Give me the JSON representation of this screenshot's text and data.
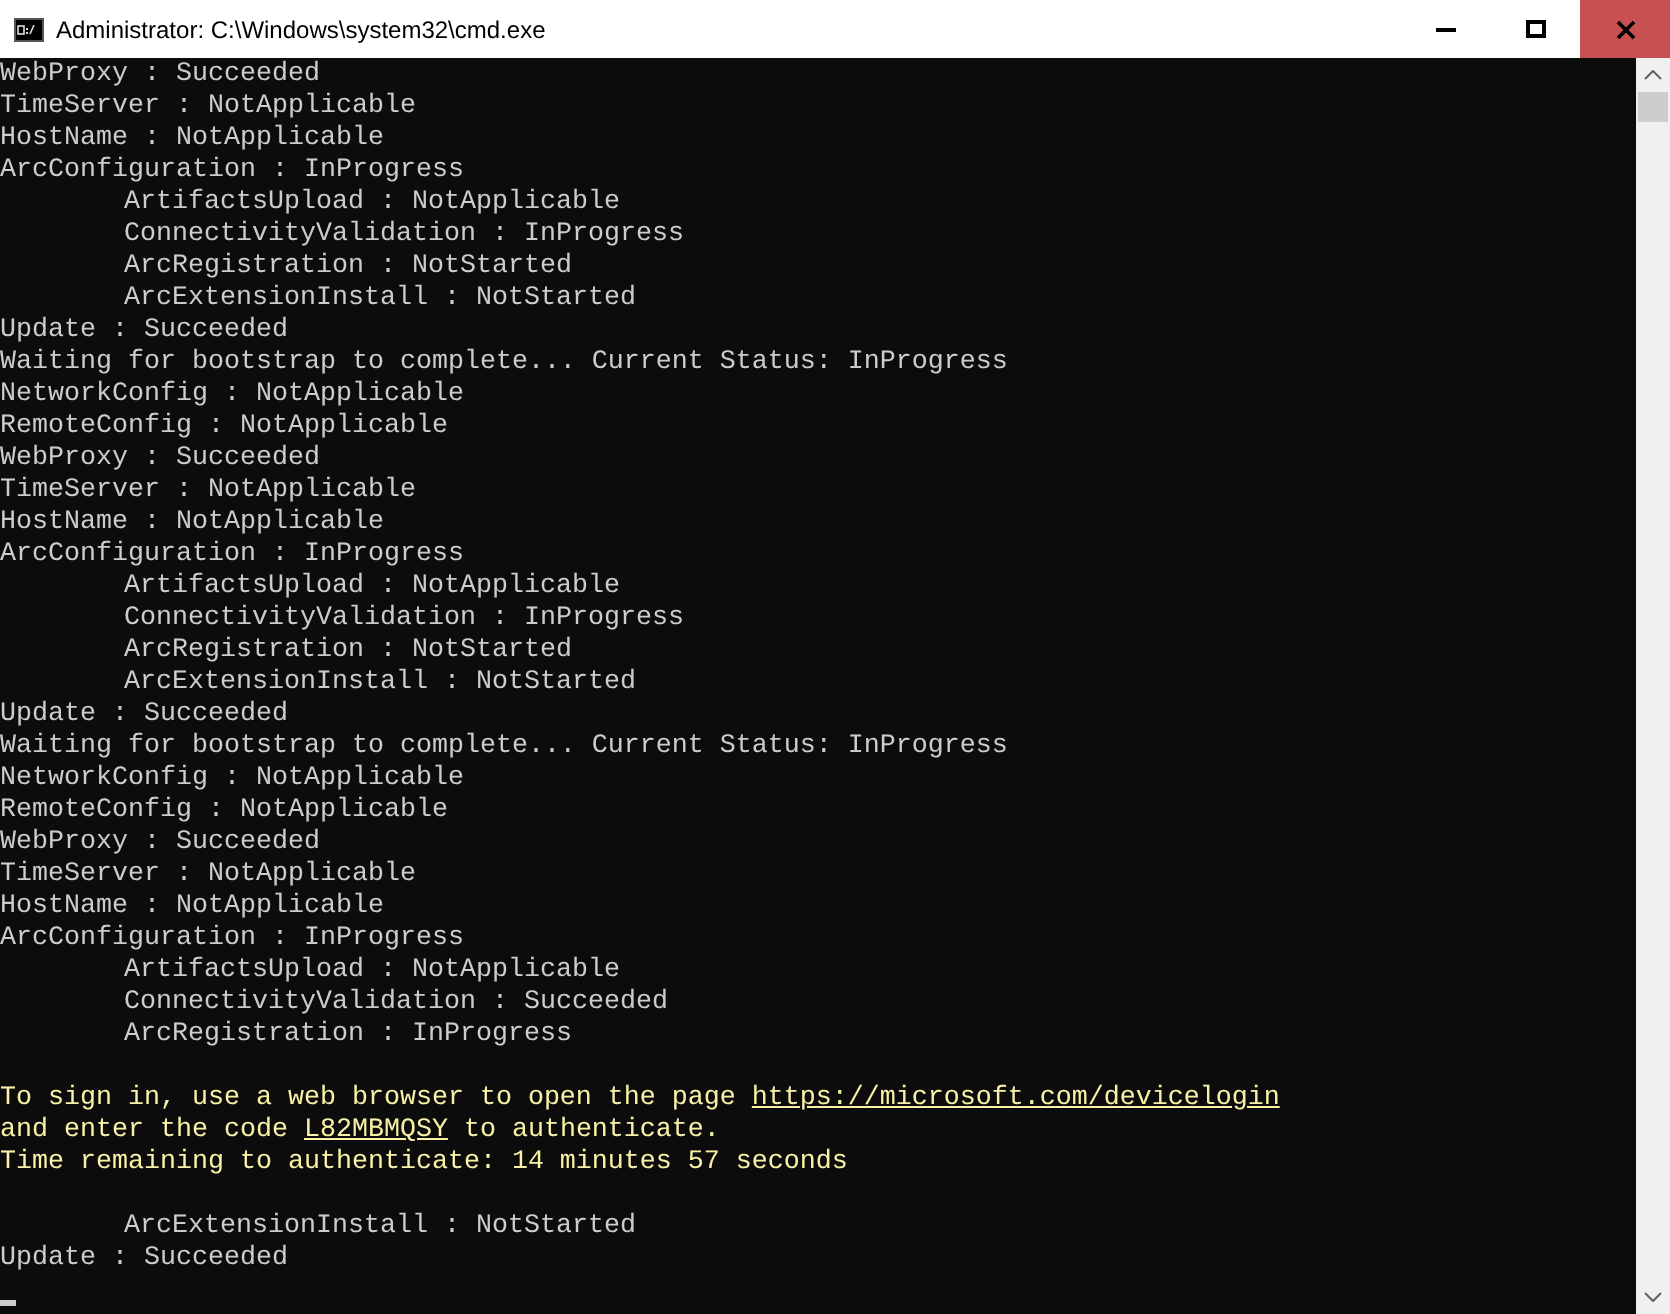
{
  "window": {
    "title": "Administrator: C:\\Windows\\system32\\cmd.exe"
  },
  "lines": [
    {
      "kind": "plain",
      "indented": false,
      "text": "WebProxy : Succeeded"
    },
    {
      "kind": "plain",
      "indented": false,
      "text": "TimeServer : NotApplicable"
    },
    {
      "kind": "plain",
      "indented": false,
      "text": "HostName : NotApplicable"
    },
    {
      "kind": "plain",
      "indented": false,
      "text": "ArcConfiguration : InProgress"
    },
    {
      "kind": "plain",
      "indented": true,
      "text": "ArtifactsUpload : NotApplicable"
    },
    {
      "kind": "plain",
      "indented": true,
      "text": "ConnectivityValidation : InProgress"
    },
    {
      "kind": "plain",
      "indented": true,
      "text": "ArcRegistration : NotStarted"
    },
    {
      "kind": "plain",
      "indented": true,
      "text": "ArcExtensionInstall : NotStarted"
    },
    {
      "kind": "plain",
      "indented": false,
      "text": "Update : Succeeded"
    },
    {
      "kind": "plain",
      "indented": false,
      "text": "Waiting for bootstrap to complete... Current Status: InProgress"
    },
    {
      "kind": "plain",
      "indented": false,
      "text": "NetworkConfig : NotApplicable"
    },
    {
      "kind": "plain",
      "indented": false,
      "text": "RemoteConfig : NotApplicable"
    },
    {
      "kind": "plain",
      "indented": false,
      "text": "WebProxy : Succeeded"
    },
    {
      "kind": "plain",
      "indented": false,
      "text": "TimeServer : NotApplicable"
    },
    {
      "kind": "plain",
      "indented": false,
      "text": "HostName : NotApplicable"
    },
    {
      "kind": "plain",
      "indented": false,
      "text": "ArcConfiguration : InProgress"
    },
    {
      "kind": "plain",
      "indented": true,
      "text": "ArtifactsUpload : NotApplicable"
    },
    {
      "kind": "plain",
      "indented": true,
      "text": "ConnectivityValidation : InProgress"
    },
    {
      "kind": "plain",
      "indented": true,
      "text": "ArcRegistration : NotStarted"
    },
    {
      "kind": "plain",
      "indented": true,
      "text": "ArcExtensionInstall : NotStarted"
    },
    {
      "kind": "plain",
      "indented": false,
      "text": "Update : Succeeded"
    },
    {
      "kind": "plain",
      "indented": false,
      "text": "Waiting for bootstrap to complete... Current Status: InProgress"
    },
    {
      "kind": "plain",
      "indented": false,
      "text": "NetworkConfig : NotApplicable"
    },
    {
      "kind": "plain",
      "indented": false,
      "text": "RemoteConfig : NotApplicable"
    },
    {
      "kind": "plain",
      "indented": false,
      "text": "WebProxy : Succeeded"
    },
    {
      "kind": "plain",
      "indented": false,
      "text": "TimeServer : NotApplicable"
    },
    {
      "kind": "plain",
      "indented": false,
      "text": "HostName : NotApplicable"
    },
    {
      "kind": "plain",
      "indented": false,
      "text": "ArcConfiguration : InProgress"
    },
    {
      "kind": "plain",
      "indented": true,
      "text": "ArtifactsUpload : NotApplicable"
    },
    {
      "kind": "plain",
      "indented": true,
      "text": "ConnectivityValidation : Succeeded"
    },
    {
      "kind": "plain",
      "indented": true,
      "text": "ArcRegistration : InProgress"
    },
    {
      "kind": "blank"
    },
    {
      "kind": "notice",
      "parts": [
        {
          "text": "To sign in, use a web browser to open the page ",
          "underlined": false
        },
        {
          "text": "https://microsoft.com/devicelogin",
          "underlined": true
        }
      ]
    },
    {
      "kind": "notice",
      "parts": [
        {
          "text": "and enter the code ",
          "underlined": false
        },
        {
          "text": "L82MBMQSY",
          "underlined": true
        },
        {
          "text": " to authenticate.",
          "underlined": false
        }
      ]
    },
    {
      "kind": "notice",
      "parts": [
        {
          "text": "Time remaining to authenticate: 14 minutes 57 seconds",
          "underlined": false
        }
      ]
    },
    {
      "kind": "blank"
    },
    {
      "kind": "plain",
      "indented": true,
      "text": "ArcExtensionInstall : NotStarted"
    },
    {
      "kind": "plain",
      "indented": false,
      "text": "Update : Succeeded"
    },
    {
      "kind": "cursor"
    }
  ]
}
